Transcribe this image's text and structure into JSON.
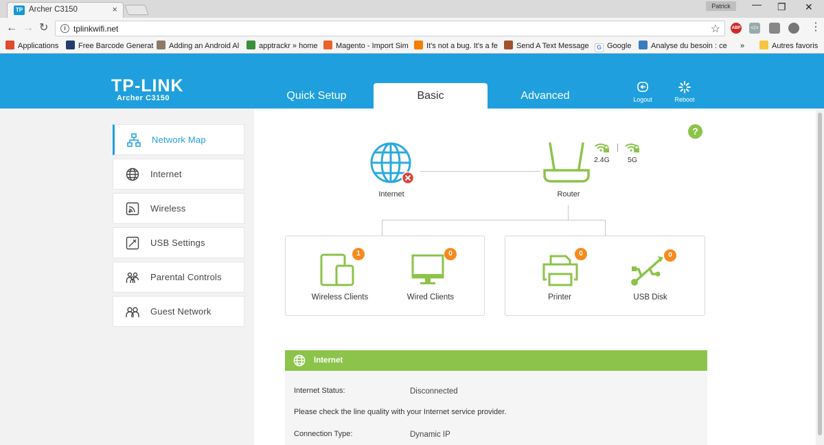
{
  "browser": {
    "tab_title": "Archer C3150",
    "tab_favicon": "TP",
    "profile_name": "Patrick",
    "url": "tplinkwifi.net",
    "bookmarks": [
      {
        "label": "Applications",
        "icon": "apps-grid-icon",
        "color": "#e04b2a"
      },
      {
        "label": "Free Barcode Generat",
        "icon": "barcode-icon",
        "color": "#223c6e"
      },
      {
        "label": "Adding an Android Al",
        "icon": "android-page-icon",
        "color": "#8a7a66"
      },
      {
        "label": "apptrackr » home",
        "icon": "apptrackr-icon",
        "color": "#3a8f3a"
      },
      {
        "label": "Magento - Import Sim",
        "icon": "magento-icon",
        "color": "#e8642b"
      },
      {
        "label": "It's not a bug. It's a fe",
        "icon": "blogger-icon",
        "color": "#f57d00"
      },
      {
        "label": "Send A Text Message",
        "icon": "text-message-icon",
        "color": "#a0522d"
      },
      {
        "label": "Google",
        "icon": "google-icon",
        "color": "#4285f4"
      },
      {
        "label": "Analyse du besoin : ce",
        "icon": "puzzle-icon",
        "color": "#3b7bbf"
      }
    ],
    "bookmarks_overflow": "»",
    "other_bookmarks": "Autres favoris"
  },
  "header": {
    "logo": "TP-LINK",
    "model": "Archer C3150",
    "tabs": {
      "quick_setup": "Quick Setup",
      "basic": "Basic",
      "advanced": "Advanced"
    },
    "logout": "Logout",
    "reboot": "Reboot",
    "accent": "#1f9fdd"
  },
  "sidebar": {
    "items": [
      {
        "label": "Network Map",
        "icon": "network-map-icon"
      },
      {
        "label": "Internet",
        "icon": "globe-icon"
      },
      {
        "label": "Wireless",
        "icon": "wireless-icon"
      },
      {
        "label": "USB Settings",
        "icon": "usb-settings-icon"
      },
      {
        "label": "Parental Controls",
        "icon": "parental-controls-icon"
      },
      {
        "label": "Guest Network",
        "icon": "guest-network-icon"
      }
    ]
  },
  "network_map": {
    "help": "?",
    "internet_label": "Internet",
    "router_label": "Router",
    "band_24": "2.4G",
    "band_5": "5G",
    "devices": [
      {
        "label": "Wireless Clients",
        "count": "1"
      },
      {
        "label": "Wired Clients",
        "count": "0"
      },
      {
        "label": "Printer",
        "count": "0"
      },
      {
        "label": "USB Disk",
        "count": "0"
      }
    ],
    "green": "#8cc34a",
    "badge_color": "#f68a1e",
    "error_color": "#e0403a"
  },
  "internet_panel": {
    "title": "Internet",
    "status_label": "Internet Status:",
    "status_value": "Disconnected",
    "note": "Please check the line quality with your Internet service provider.",
    "conn_type_label": "Connection Type:",
    "conn_type_value": "Dynamic IP"
  }
}
